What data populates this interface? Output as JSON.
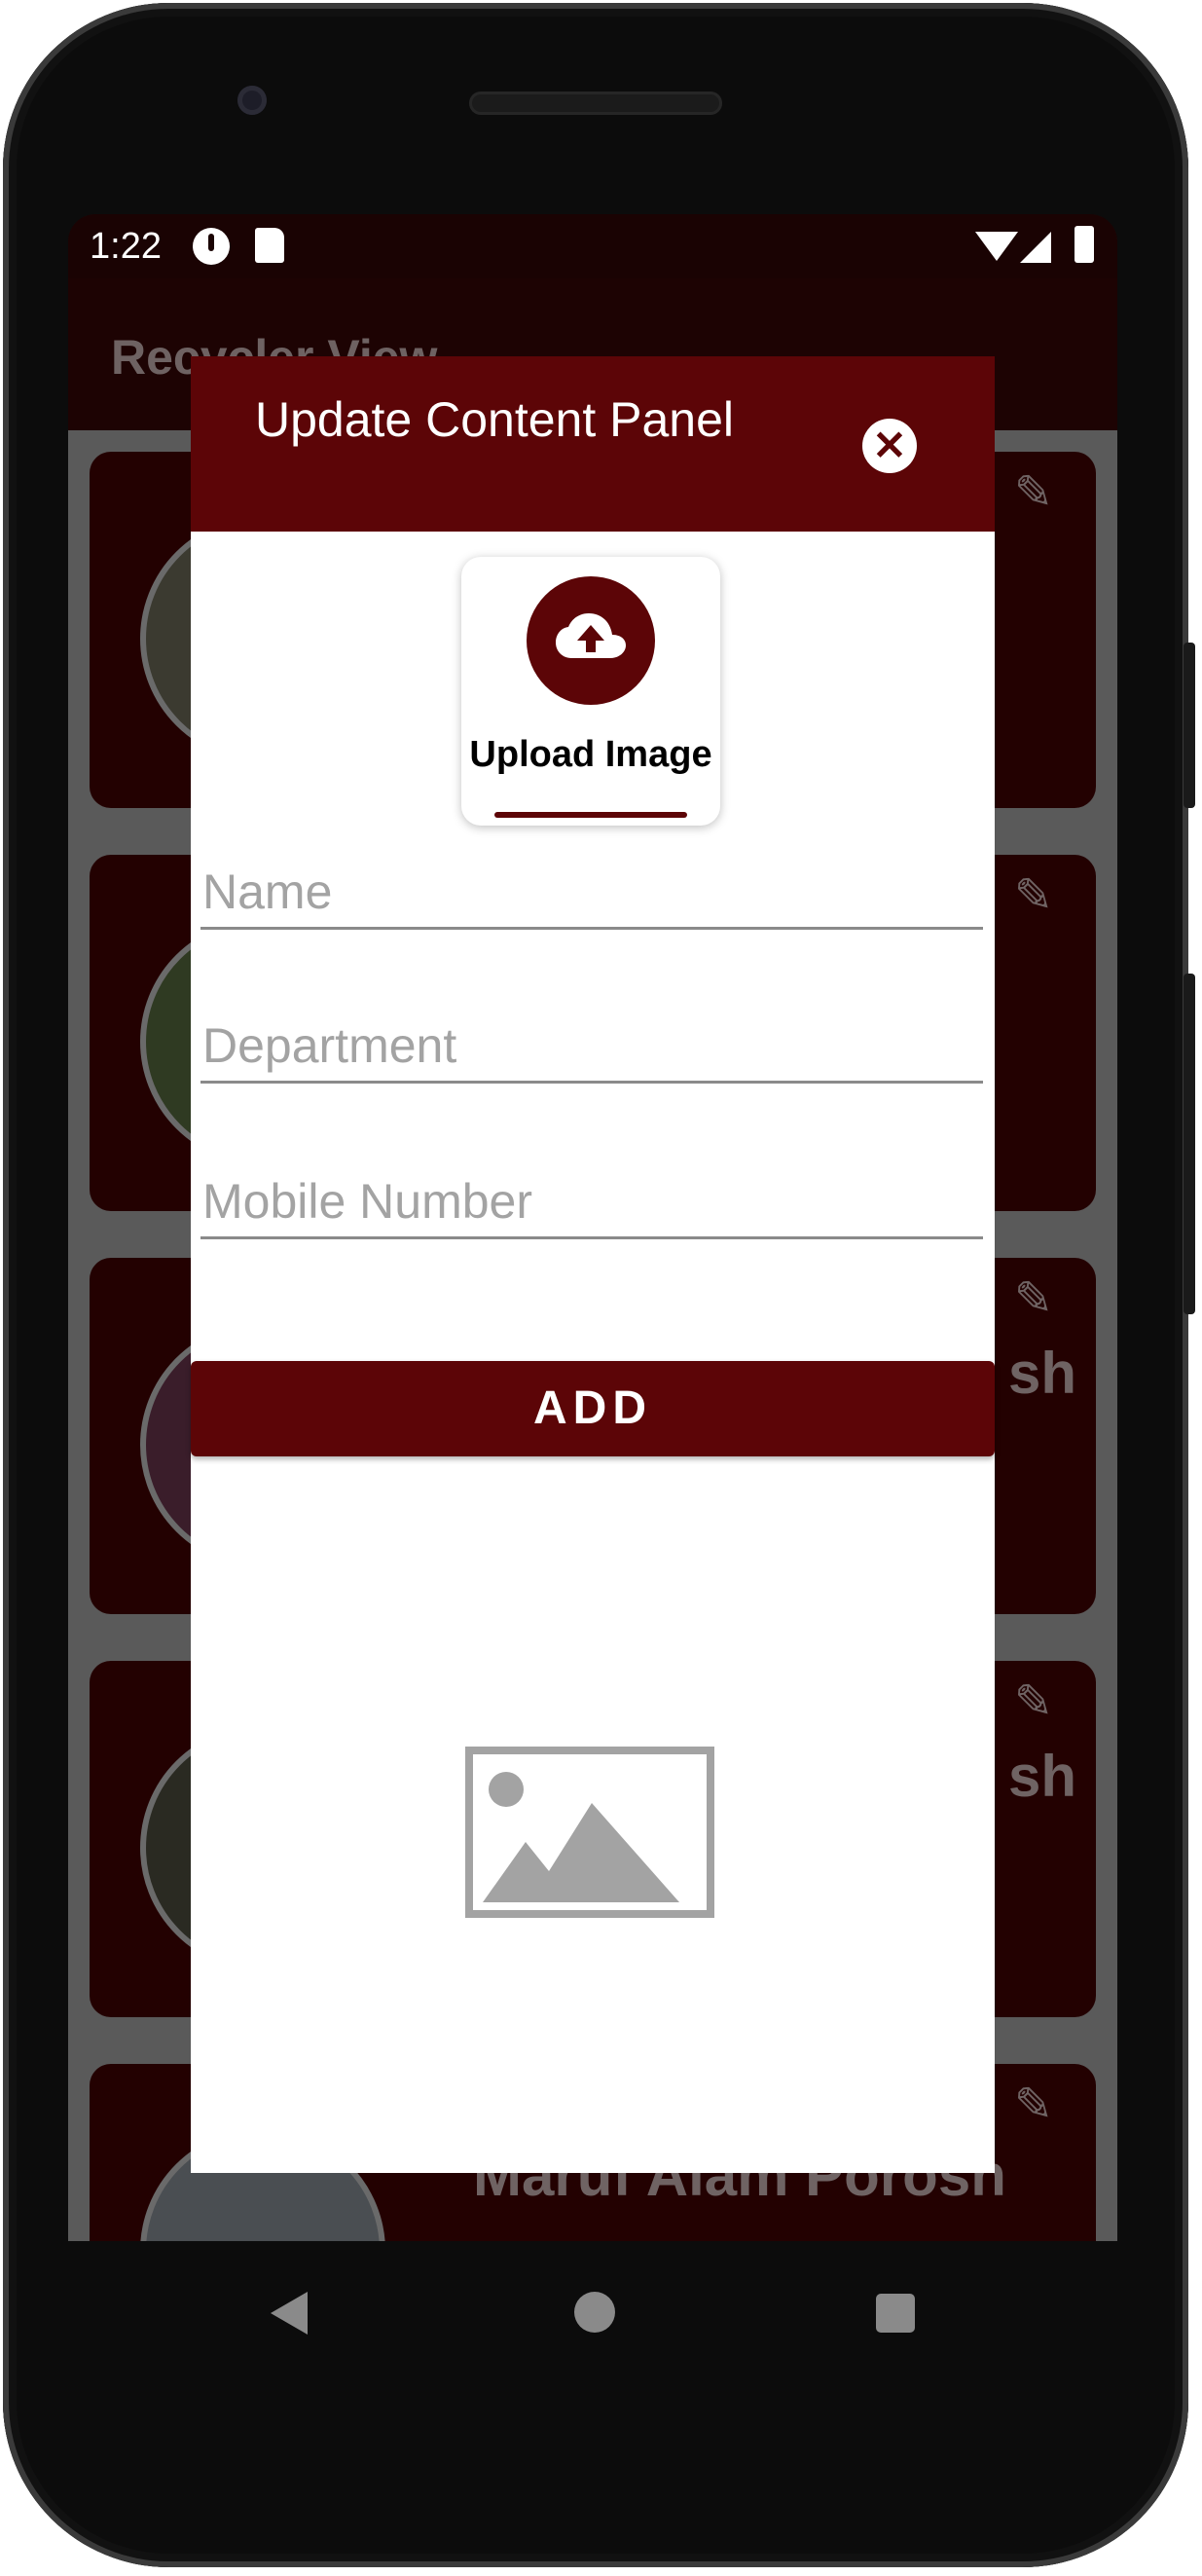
{
  "status_bar": {
    "time": "1:22"
  },
  "app": {
    "title": "Recycler View",
    "cards": [
      {
        "name": ""
      },
      {
        "name": ""
      },
      {
        "name": "sh"
      },
      {
        "name": "sh"
      },
      {
        "name": "Maruf Alam Porosh"
      }
    ]
  },
  "dialog": {
    "title": "Update Content Panel",
    "upload_label": "Upload Image",
    "fields": {
      "name_placeholder": "Name",
      "department_placeholder": "Department",
      "mobile_placeholder": "Mobile Number"
    },
    "add_label": "ADD"
  },
  "colors": {
    "primary": "#5c0507",
    "scrim": "#5a5a5a"
  },
  "icons": {
    "close": "close-icon",
    "upload": "cloud-upload-icon",
    "edit": "pencil-icon",
    "image_placeholder": "image-placeholder-icon"
  }
}
